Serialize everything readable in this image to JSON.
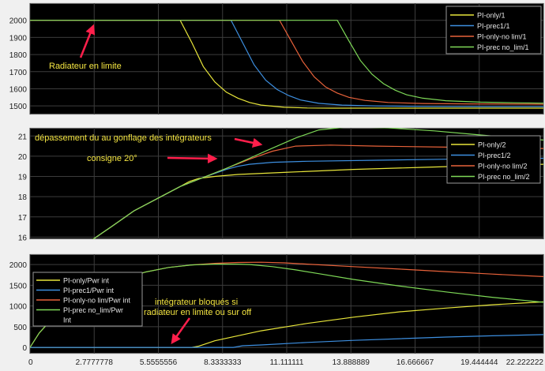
{
  "chart_data": [
    {
      "type": "line",
      "title": "",
      "xlabel": "",
      "ylabel": "",
      "xlim": [
        0,
        22.222222
      ],
      "ylim": [
        1450,
        2100
      ],
      "yticks": [
        1500,
        1600,
        1700,
        1800,
        1900,
        2000
      ],
      "grid": true,
      "legend": {
        "placement": "top-right"
      },
      "series": [
        {
          "name": "PI-only/1",
          "color": "#e8e63a",
          "x": [
            0,
            6.5,
            7.0,
            7.5,
            8.0,
            8.5,
            9.0,
            9.5,
            10.0,
            11.0,
            12.0,
            13.0,
            15.0,
            18.0,
            22.222222
          ],
          "y": [
            2000,
            2000,
            1870,
            1730,
            1640,
            1580,
            1545,
            1520,
            1505,
            1492,
            1488,
            1487,
            1487,
            1487,
            1487
          ]
        },
        {
          "name": "PI-prec1/1",
          "color": "#3d8fe0",
          "x": [
            0,
            8.7,
            9.2,
            9.7,
            10.2,
            10.7,
            11.2,
            11.7,
            12.5,
            13.5,
            15.0,
            17.0,
            20.0,
            22.222222
          ],
          "y": [
            2000,
            2000,
            1870,
            1740,
            1650,
            1595,
            1560,
            1535,
            1515,
            1505,
            1500,
            1497,
            1495,
            1495
          ]
        },
        {
          "name": "PI-only-no lim/1",
          "color": "#e8623a",
          "x": [
            0,
            10.8,
            11.3,
            11.8,
            12.3,
            12.8,
            13.3,
            13.8,
            14.5,
            15.5,
            17.0,
            19.0,
            22.222222
          ],
          "y": [
            2000,
            2000,
            1880,
            1760,
            1670,
            1610,
            1575,
            1550,
            1532,
            1520,
            1514,
            1512,
            1510
          ]
        },
        {
          "name": "PI-prec no_lim/1",
          "color": "#7ed957",
          "x": [
            0,
            13.3,
            13.8,
            14.3,
            14.8,
            15.3,
            15.8,
            16.3,
            17.0,
            18.0,
            19.5,
            21.0,
            22.222222
          ],
          "y": [
            2000,
            2000,
            1880,
            1765,
            1685,
            1630,
            1592,
            1565,
            1545,
            1530,
            1522,
            1518,
            1516
          ]
        }
      ],
      "annotations": [
        {
          "text": "Radiateur en limite",
          "color": "#f5e642"
        }
      ]
    },
    {
      "type": "line",
      "title": "",
      "xlabel": "",
      "ylabel": "",
      "xlim": [
        0,
        22.222222
      ],
      "ylim": [
        15.9,
        21.4
      ],
      "yticks": [
        16,
        17,
        18,
        19,
        20,
        21
      ],
      "grid": true,
      "legend": {
        "placement": "right"
      },
      "series": [
        {
          "name": "PI-only/2",
          "color": "#e8e63a",
          "x": [
            0,
            2.6,
            3.5,
            4.5,
            5.5,
            6.5,
            6.9,
            7.3,
            8.0,
            9.0,
            11.0,
            14.0,
            17.0,
            20.0,
            22.222222
          ],
          "y": [
            15.8,
            15.8,
            16.5,
            17.3,
            17.9,
            18.5,
            18.75,
            18.9,
            19.0,
            19.1,
            19.2,
            19.35,
            19.45,
            19.55,
            19.6
          ]
        },
        {
          "name": "PI-prec1/2",
          "color": "#3d8fe0",
          "x": [
            0,
            2.6,
            3.5,
            4.5,
            5.5,
            6.5,
            7.5,
            8.5,
            9.0,
            9.5,
            10.5,
            12.0,
            15.0,
            18.0,
            22.222222
          ],
          "y": [
            15.8,
            15.8,
            16.5,
            17.3,
            17.9,
            18.5,
            18.95,
            19.35,
            19.5,
            19.6,
            19.7,
            19.75,
            19.8,
            19.85,
            19.9
          ]
        },
        {
          "name": "PI-only-no lim/2",
          "color": "#e8623a",
          "x": [
            0,
            2.6,
            3.5,
            4.5,
            5.5,
            6.5,
            7.5,
            8.5,
            9.5,
            10.5,
            11.5,
            13.0,
            15.0,
            18.0,
            21.0,
            22.222222
          ],
          "y": [
            15.8,
            15.8,
            16.5,
            17.3,
            17.9,
            18.5,
            18.95,
            19.4,
            19.85,
            20.25,
            20.5,
            20.55,
            20.5,
            20.45,
            20.4,
            20.38
          ]
        },
        {
          "name": "PI-prec no_lim/2",
          "color": "#7ed957",
          "x": [
            0,
            2.6,
            3.5,
            4.5,
            5.5,
            6.5,
            7.5,
            8.5,
            9.5,
            10.5,
            11.5,
            12.5,
            13.8,
            15.5,
            17.5,
            19.5,
            21.0,
            22.222222
          ],
          "y": [
            15.8,
            15.8,
            16.5,
            17.3,
            17.9,
            18.5,
            18.95,
            19.4,
            19.9,
            20.4,
            20.9,
            21.3,
            21.45,
            21.4,
            21.25,
            21.05,
            20.9,
            20.8
          ]
        }
      ],
      "annotations": [
        {
          "text": "dépassement du au gonflage des intégrateurs",
          "color": "#f5e642"
        },
        {
          "text": "consigne 20°",
          "color": "#f5e642"
        }
      ]
    },
    {
      "type": "line",
      "title": "",
      "xlabel": "",
      "ylabel": "",
      "xlim": [
        0,
        22.222222
      ],
      "ylim": [
        -150,
        2250
      ],
      "yticks": [
        0,
        500,
        1000,
        1500,
        2000
      ],
      "xticks": [
        0,
        2.7777778,
        5.5555556,
        8.3333333,
        11.111111,
        13.888889,
        16.666667,
        19.444444,
        22.222222
      ],
      "xtick_labels": [
        "0",
        "2.7777778",
        "5.5555556",
        "8.3333333",
        "11.111111",
        "13.888889",
        "16.666667",
        "19.444444",
        "22.222222"
      ],
      "grid": true,
      "legend": {
        "placement": "left"
      },
      "series": [
        {
          "name": "PI-only/Pwr int",
          "color": "#e8e63a",
          "x": [
            0,
            7.0,
            7.3,
            8.0,
            10.0,
            12.0,
            14.0,
            16.0,
            18.0,
            20.0,
            22.222222
          ],
          "y": [
            0,
            0,
            30,
            160,
            400,
            580,
            730,
            860,
            950,
            1030,
            1100
          ]
        },
        {
          "name": "PI-prec1/Pwr int",
          "color": "#3d8fe0",
          "x": [
            0,
            8.8,
            9.2,
            10.0,
            12.0,
            14.0,
            16.0,
            18.0,
            20.0,
            22.222222
          ],
          "y": [
            0,
            0,
            40,
            60,
            120,
            170,
            210,
            250,
            280,
            310
          ]
        },
        {
          "name": "PI-only-no lim/Pwr int",
          "color": "#e8623a",
          "x": [
            0,
            0.4,
            1.0,
            2.0,
            3.0,
            4.0,
            5.0,
            6.0,
            7.0,
            8.0,
            9.0,
            10.0,
            11.0,
            12.0,
            14.0,
            16.0,
            18.0,
            20.0,
            22.222222
          ],
          "y": [
            0,
            350,
            720,
            1120,
            1420,
            1650,
            1820,
            1930,
            1990,
            2030,
            2050,
            2055,
            2040,
            2010,
            1950,
            1890,
            1830,
            1770,
            1710
          ]
        },
        {
          "name": "PI-prec no_lim/Pwr int",
          "color": "#7ed957",
          "x": [
            0,
            0.4,
            1.0,
            2.0,
            3.0,
            4.0,
            5.0,
            6.0,
            7.0,
            8.0,
            9.0,
            9.5,
            10.5,
            11.5,
            12.5,
            14.0,
            16.0,
            18.0,
            20.0,
            22.222222
          ],
          "y": [
            0,
            350,
            720,
            1120,
            1420,
            1650,
            1820,
            1930,
            1990,
            2010,
            2010,
            2000,
            1950,
            1870,
            1780,
            1640,
            1480,
            1340,
            1210,
            1090
          ]
        }
      ],
      "legend_entries": [
        "PI-only/Pwr int",
        "PI-prec1/Pwr int",
        "PI-only-no lim/Pwr int",
        "PI-prec no_lim/Pwr",
        "Int"
      ],
      "annotations": [
        {
          "text": "intégrateur bloqués si",
          "color": "#f5e642"
        },
        {
          "text": "radiateur en limite ou sur off",
          "color": "#f5e642"
        }
      ]
    }
  ]
}
